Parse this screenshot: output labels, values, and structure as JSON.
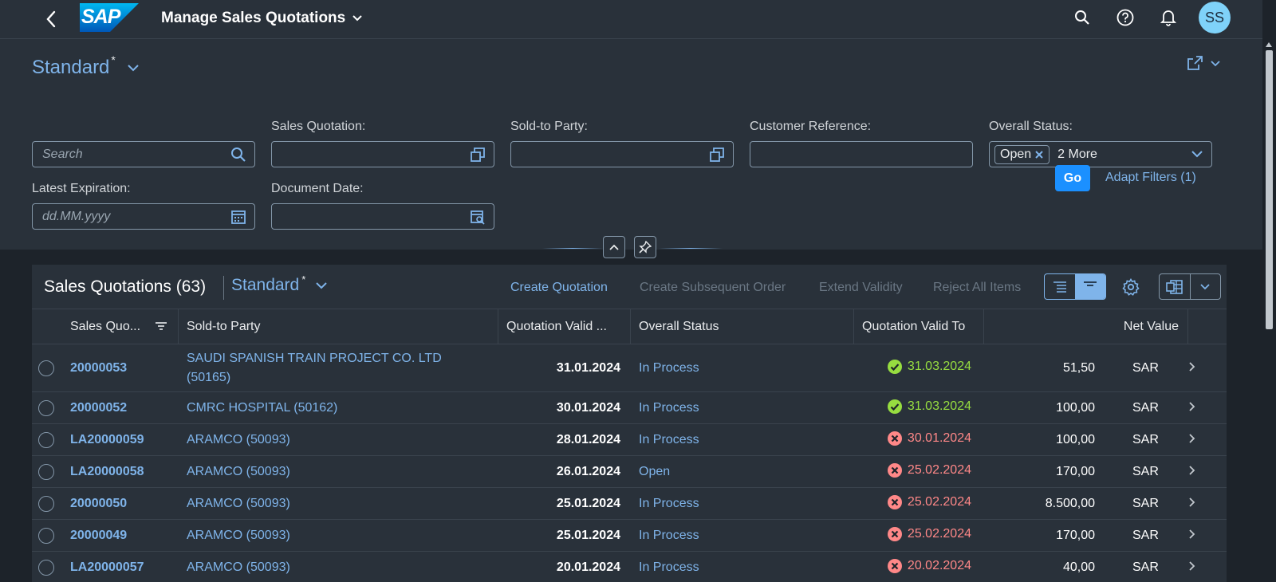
{
  "shell": {
    "logo_text": "SAP",
    "app_title": "Manage Sales Quotations",
    "avatar_initials": "SS"
  },
  "header": {
    "variant_name": "Standard",
    "variant_modified": "*"
  },
  "filters": {
    "search_placeholder": "Search",
    "sales_quotation_label": "Sales Quotation:",
    "sold_to_party_label": "Sold-to Party:",
    "customer_reference_label": "Customer Reference:",
    "overall_status_label": "Overall Status:",
    "overall_status_token": "Open",
    "overall_status_more": "2 More",
    "latest_expiration_label": "Latest Expiration:",
    "latest_expiration_placeholder": "dd.MM.yyyy",
    "document_date_label": "Document Date:",
    "go_label": "Go",
    "adapt_filters_label": "Adapt Filters (1)"
  },
  "table": {
    "title": "Sales Quotations (63)",
    "variant_name": "Standard",
    "variant_modified": "*",
    "actions": {
      "create_quotation": "Create Quotation",
      "create_subsequent_order": "Create Subsequent Order",
      "extend_validity": "Extend Validity",
      "reject_all_items": "Reject All Items"
    },
    "columns": {
      "sales_quotation": "Sales Quo...",
      "sold_to_party": "Sold-to Party",
      "quotation_valid_from": "Quotation Valid ...",
      "overall_status": "Overall Status",
      "quotation_valid_to": "Quotation Valid To",
      "net_value": "Net Value"
    },
    "rows": [
      {
        "id": "20000053",
        "party": "SAUDI SPANISH TRAIN PROJECT CO. LTD (50165)",
        "valid_from": "31.01.2024",
        "status": "In Process",
        "valid_to": "31.03.2024",
        "valid_state": "ok",
        "net": "51,50",
        "currency": "SAR"
      },
      {
        "id": "20000052",
        "party": "CMRC HOSPITAL (50162)",
        "valid_from": "30.01.2024",
        "status": "In Process",
        "valid_to": "31.03.2024",
        "valid_state": "ok",
        "net": "100,00",
        "currency": "SAR"
      },
      {
        "id": "LA20000059",
        "party": "ARAMCO (50093)",
        "valid_from": "28.01.2024",
        "status": "In Process",
        "valid_to": "30.01.2024",
        "valid_state": "expired",
        "net": "100,00",
        "currency": "SAR"
      },
      {
        "id": "LA20000058",
        "party": "ARAMCO (50093)",
        "valid_from": "26.01.2024",
        "status": "Open",
        "valid_to": "25.02.2024",
        "valid_state": "expired",
        "net": "170,00",
        "currency": "SAR"
      },
      {
        "id": "20000050",
        "party": "ARAMCO (50093)",
        "valid_from": "25.01.2024",
        "status": "In Process",
        "valid_to": "25.02.2024",
        "valid_state": "expired",
        "net": "8.500,00",
        "currency": "SAR"
      },
      {
        "id": "20000049",
        "party": "ARAMCO (50093)",
        "valid_from": "25.01.2024",
        "status": "In Process",
        "valid_to": "25.02.2024",
        "valid_state": "expired",
        "net": "170,00",
        "currency": "SAR"
      },
      {
        "id": "LA20000057",
        "party": "ARAMCO (50093)",
        "valid_from": "20.01.2024",
        "status": "In Process",
        "valid_to": "20.02.2024",
        "valid_state": "expired",
        "net": "40,00",
        "currency": "SAR"
      }
    ]
  },
  "colors": {
    "shell_bg": "#29313a",
    "page_bg": "#1d232a",
    "link": "#7fb4ea",
    "emphasized_button": "#1b90ff",
    "positive": "#97dd40",
    "negative": "#ff8888"
  }
}
